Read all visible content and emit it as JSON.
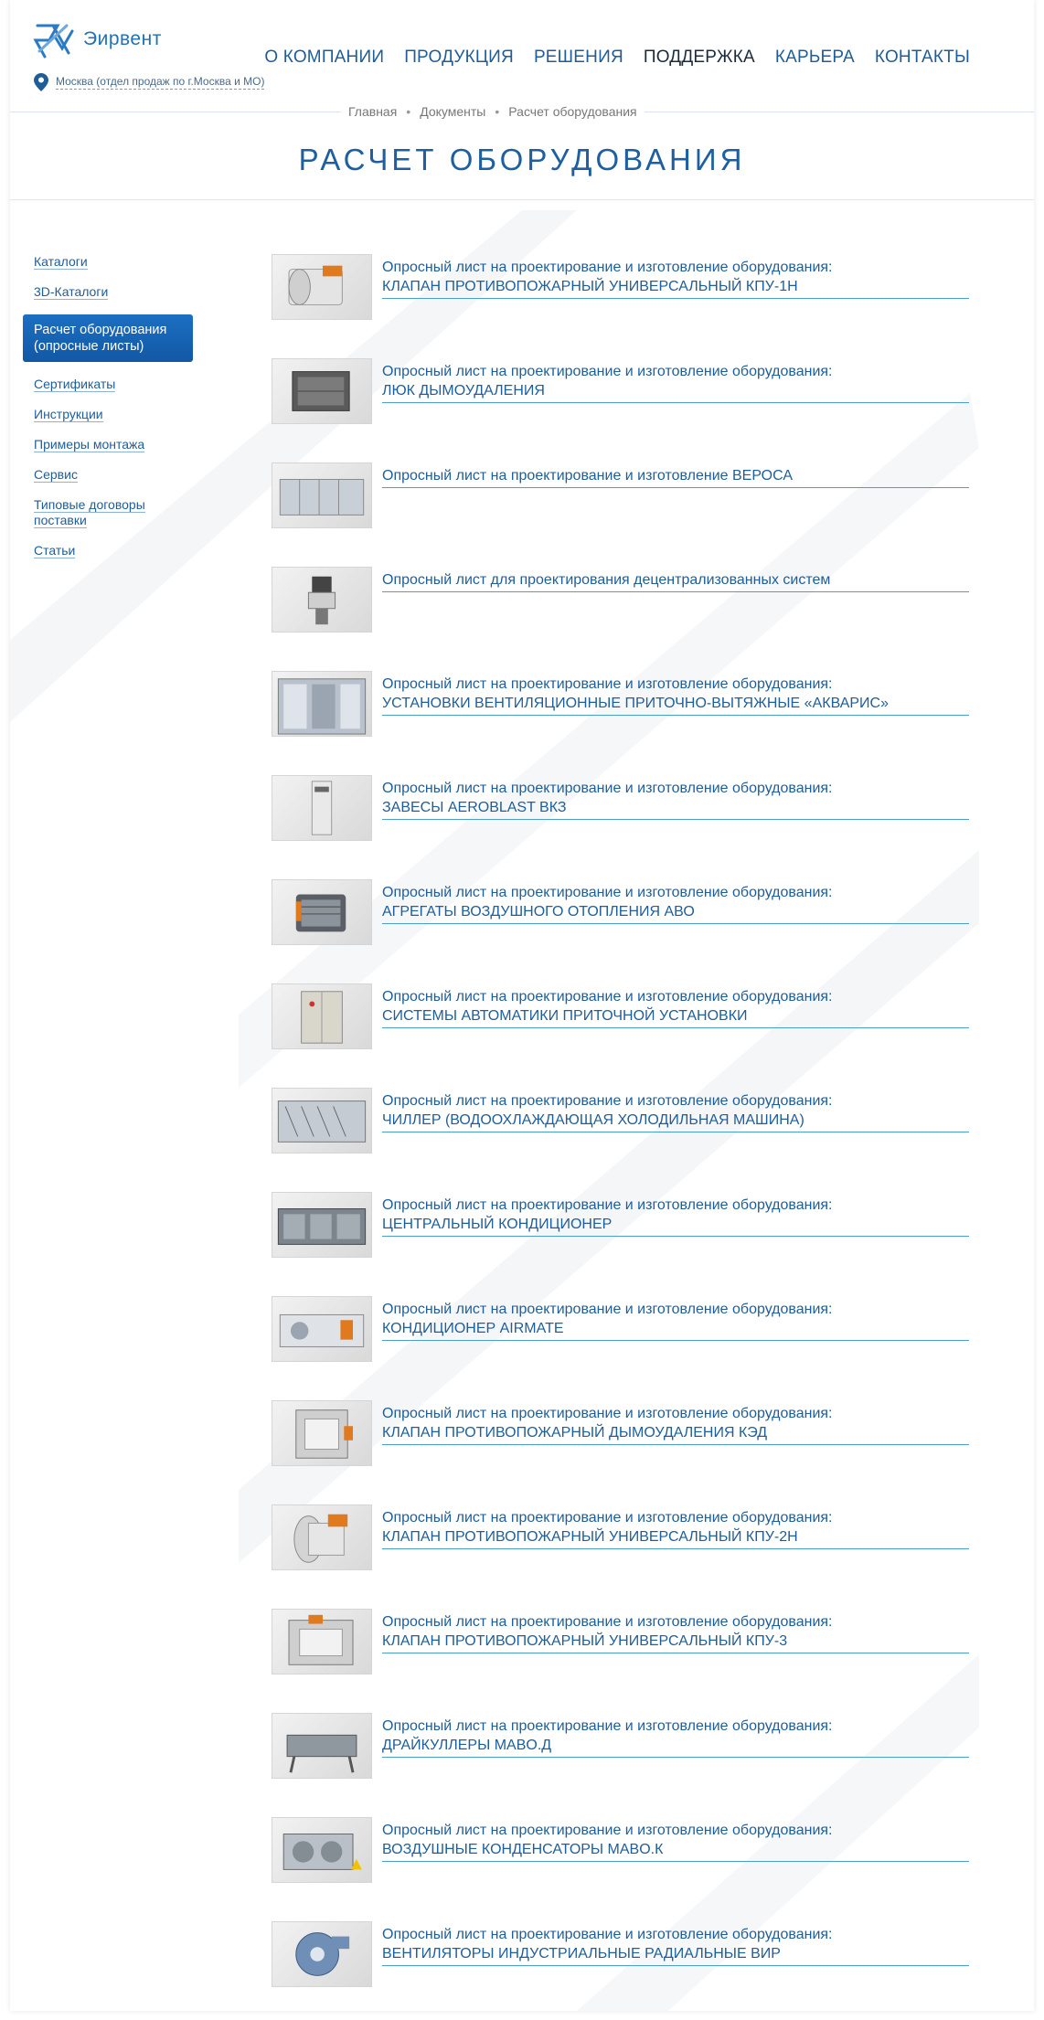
{
  "header": {
    "logo_text": "Эирвент",
    "city": "Москва (отдел продаж по г.Москва и МО)",
    "nav": [
      {
        "label": "О КОМПАНИИ",
        "active": false
      },
      {
        "label": "ПРОДУКЦИЯ",
        "active": false
      },
      {
        "label": "РЕШЕНИЯ",
        "active": false
      },
      {
        "label": "ПОДДЕРЖКА",
        "active": true
      },
      {
        "label": "КАРЬЕРА",
        "active": false
      },
      {
        "label": "КОНТАКТЫ",
        "active": false
      }
    ]
  },
  "breadcrumb": [
    "Главная",
    "Документы",
    "Расчет оборудования"
  ],
  "page_title": "РАСЧЕТ ОБОРУДОВАНИЯ",
  "sidebar": {
    "items": [
      {
        "label": "Каталоги"
      },
      {
        "label": "3D-Каталоги"
      },
      {
        "label": "Расчет оборудования (опросные листы)",
        "active": true
      },
      {
        "label": "Сертификаты"
      },
      {
        "label": "Инструкции"
      },
      {
        "label": "Примеры монтажа"
      },
      {
        "label": "Сервис"
      },
      {
        "label": "Типовые договоры поставки"
      },
      {
        "label": "Статьи"
      }
    ]
  },
  "documents": [
    {
      "line1": "Опросный лист на проектирование и изготовление оборудования:",
      "line2": "КЛАПАН ПРОТИВОПОЖАРНЫЙ УНИВЕРСАЛЬНЫЙ КПУ-1Н",
      "icon": "round-valve"
    },
    {
      "line1": "Опросный лист на проектирование и изготовление оборудования:",
      "line2": "ЛЮК ДЫМОУДАЛЕНИЯ",
      "icon": "smoke-hatch"
    },
    {
      "line1": "Опросный лист на проектирование и изготовление ВЕРОСА",
      "line2": "",
      "icon": "ahu"
    },
    {
      "line1": "Опросный лист для проектирования децентрализованных систем",
      "line2": "",
      "icon": "roof-unit"
    },
    {
      "line1": "Опросный лист на проектирование и изготовление оборудования:",
      "line2": "УСТАНОВКИ ВЕНТИЛЯЦИОННЫЕ ПРИТОЧНО-ВЫТЯЖНЫЕ «АКВАРИС»",
      "icon": "ahu-open"
    },
    {
      "line1": "Опросный лист на проектирование и изготовление оборудования:",
      "line2": "ЗАВЕСЫ AEROBLAST ВКЗ",
      "icon": "air-curtain"
    },
    {
      "line1": "Опросный лист на проектирование и изготовление оборудования:",
      "line2": "АГРЕГАТЫ ВОЗДУШНОГО ОТОПЛЕНИЯ АВО",
      "icon": "heater"
    },
    {
      "line1": "Опросный лист на проектирование и изготовление оборудования:",
      "line2": "СИСТЕМЫ АВТОМАТИКИ ПРИТОЧНОЙ УСТАНОВКИ",
      "icon": "cabinet"
    },
    {
      "line1": "Опросный лист на проектирование и изготовление оборудования:",
      "line2": "ЧИЛЛЕР (ВОДООХЛАЖДАЮЩАЯ ХОЛОДИЛЬНАЯ МАШИНА)",
      "icon": "chiller"
    },
    {
      "line1": "Опросный лист на проектирование и изготовление оборудования:",
      "line2": "ЦЕНТРАЛЬНЫЙ КОНДИЦИОНЕР",
      "icon": "ahu-dark"
    },
    {
      "line1": "Опросный лист на проектирование и изготовление оборудования:",
      "line2": "КОНДИЦИОНЕР AIRMATE",
      "icon": "airmate"
    },
    {
      "line1": "Опросный лист на проектирование и изготовление оборудования:",
      "line2": "КЛАПАН ПРОТИВОПОЖАРНЫЙ ДЫМОУДАЛЕНИЯ КЭД",
      "icon": "square-valve"
    },
    {
      "line1": "Опросный лист на проектирование и изготовление оборудования:",
      "line2": "КЛАПАН ПРОТИВОПОЖАРНЫЙ УНИВЕРСАЛЬНЫЙ КПУ-2Н",
      "icon": "round-valve-2"
    },
    {
      "line1": "Опросный лист на проектирование и изготовление оборудования:",
      "line2": "КЛАПАН ПРОТИВОПОЖАРНЫЙ УНИВЕРСАЛЬНЫЙ КПУ-3",
      "icon": "square-valve-2"
    },
    {
      "line1": "Опросный лист на проектирование и изготовление оборудования:",
      "line2": "ДРАЙКУЛЛЕРЫ MABO.Д",
      "icon": "drycooler"
    },
    {
      "line1": "Опросный лист на проектирование и изготовление оборудования:",
      "line2": "ВОЗДУШНЫЕ КОНДЕНСАТОРЫ MABO.К",
      "icon": "condenser"
    },
    {
      "line1": "Опросный лист на проектирование и изготовление оборудования:",
      "line2": "ВЕНТИЛЯТОРЫ ИНДУСТРИАЛЬНЫЕ РАДИАЛЬНЫЕ ВИР",
      "icon": "fan"
    }
  ],
  "colors": {
    "accent": "#1f5d99",
    "active_bg": "#1258a5",
    "underline": "#4a9ed0",
    "title": "#1d5fa0"
  }
}
